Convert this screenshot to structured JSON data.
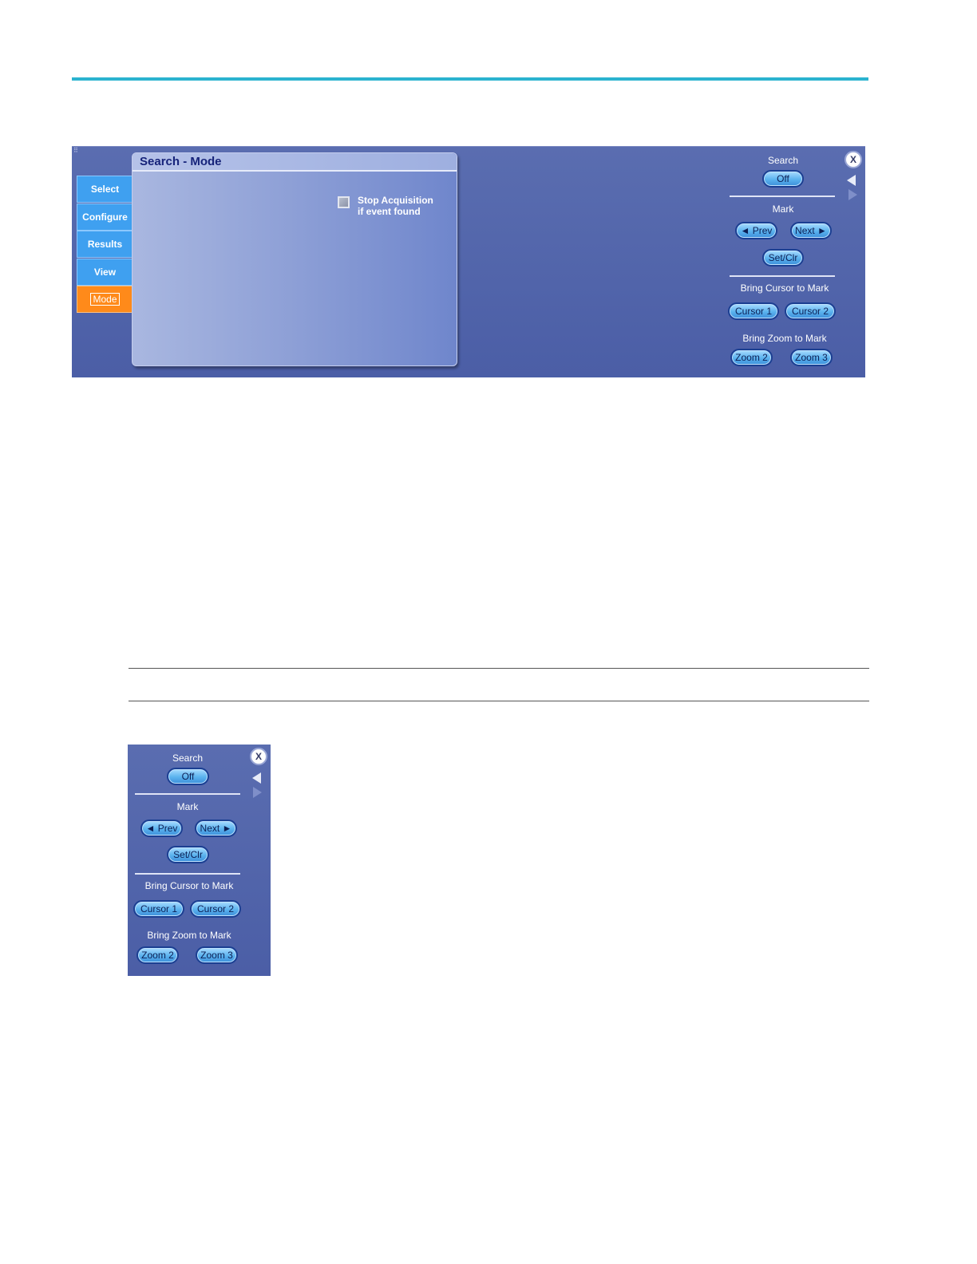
{
  "tabs": [
    {
      "label": "Select"
    },
    {
      "label": "Configure"
    },
    {
      "label": "Results"
    },
    {
      "label": "View"
    },
    {
      "label": "Mode"
    }
  ],
  "mode_panel": {
    "title": "Search - Mode",
    "stop_acquisition": {
      "line1": "Stop Acquisition",
      "line2": "if event found",
      "checked": false
    }
  },
  "controls": {
    "search_label": "Search",
    "search_button": "Off",
    "mark_label": "Mark",
    "prev_button": "◄ Prev",
    "next_button": "Next ►",
    "setclr_button": "Set/Clr",
    "bring_cursor_label": "Bring Cursor to Mark",
    "cursor1_button": "Cursor 1",
    "cursor2_button": "Cursor 2",
    "bring_zoom_label": "Bring Zoom to Mark",
    "zoom2_button": "Zoom 2",
    "zoom3_button": "Zoom 3",
    "close_button": "X"
  },
  "icons": {
    "collapse": "triangle-left-icon",
    "expand": "triangle-right-icon",
    "close": "close-icon"
  },
  "colors": {
    "panel": "#4f62a9",
    "tab": "#3fa0f0",
    "tab_active": "#ff8a1a",
    "button": "#5ab2ee",
    "accent_rule": "#2bb3cf"
  }
}
